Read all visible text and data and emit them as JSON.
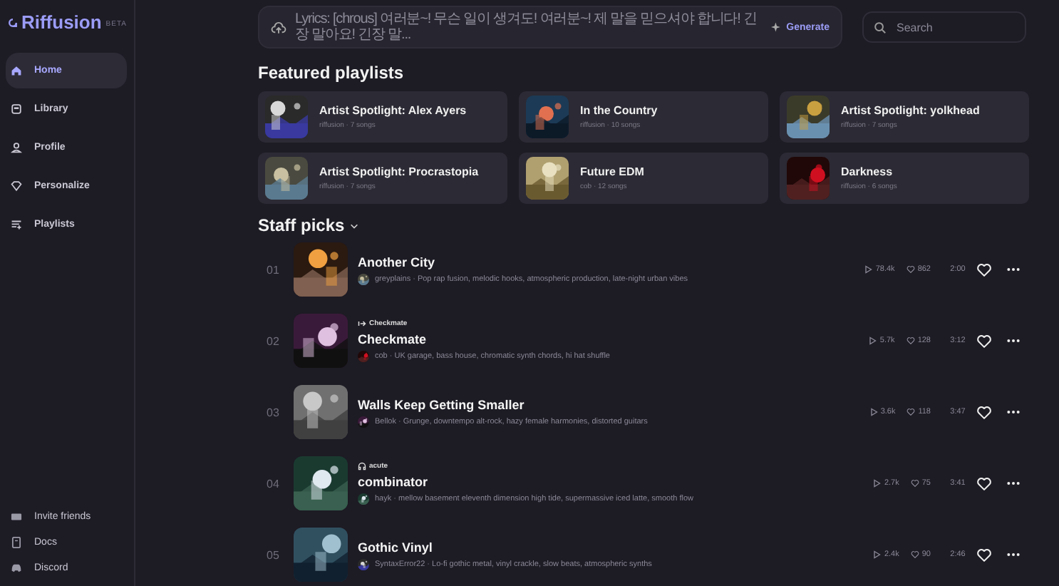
{
  "sidebar": {
    "logo": "Riffusion",
    "badge": "BETA",
    "items": [
      {
        "label": "Home",
        "selected": true
      },
      {
        "label": "Library",
        "selected": false
      },
      {
        "label": "Profile",
        "selected": false
      },
      {
        "label": "Personalize",
        "selected": false
      },
      {
        "label": "Playlists",
        "selected": false
      }
    ],
    "footer_items": [
      "Invite friends",
      "Docs",
      "Discord"
    ]
  },
  "prompt": {
    "value": "Lyrics: [chrous] 여러분~! 무슨 일이 생겨도! 여러분~! 제 말을 믿으셔야 합니다! 긴장 말아요! 긴장 말...",
    "generate": "Generate"
  },
  "search": {
    "placeholder": "Search"
  },
  "featured": {
    "title": "Featured playlists",
    "playlists": [
      {
        "title": "Artist Spotlight: Alex Ayers",
        "meta": "riffusion · 7 songs"
      },
      {
        "title": "In the Country",
        "meta": "riffusion · 10 songs"
      },
      {
        "title": "Artist Spotlight: yolkhead",
        "meta": "riffusion · 7 songs"
      },
      {
        "title": "Artist Spotlight: Procrastopia",
        "meta": "riffusion · 7 songs"
      },
      {
        "title": "Future EDM",
        "meta": "cob · 12 songs"
      },
      {
        "title": "Darkness",
        "meta": "riffusion · 6 songs"
      }
    ]
  },
  "staff_picks": {
    "title": "Staff picks",
    "tracks": [
      {
        "number": "01",
        "title": "Another City",
        "description": "greyplains · Pop rap fusion, melodic hooks, atmospheric production, late-night urban vibes",
        "plays": "78.4k",
        "likes": "862",
        "duration": "2:00"
      },
      {
        "number": "02",
        "tag": {
          "kind": "remix",
          "label": "Checkmate"
        },
        "title": "Checkmate",
        "description": "cob · UK garage, bass house, chromatic synth chords, hi hat shuffle",
        "plays": "5.7k",
        "likes": "128",
        "duration": "3:12"
      },
      {
        "number": "03",
        "title": "Walls Keep Getting Smaller",
        "description": "Bellok · Grunge, downtempo alt-rock, hazy female harmonies, distorted guitars",
        "plays": "3.6k",
        "likes": "118",
        "duration": "3:47"
      },
      {
        "number": "04",
        "tag": {
          "kind": "cover",
          "label": "acute"
        },
        "title": "combinator",
        "description": "hayk · mellow basement eleventh dimension high tide, supermassive iced latte, smooth flow",
        "plays": "2.7k",
        "likes": "75",
        "duration": "3:41"
      },
      {
        "number": "05",
        "title": "Gothic Vinyl",
        "description": "SyntaxError22 · Lo-fi gothic metal, vinyl crackle, slow beats, atmospheric synths",
        "plays": "2.4k",
        "likes": "90",
        "duration": "2:46"
      }
    ]
  }
}
